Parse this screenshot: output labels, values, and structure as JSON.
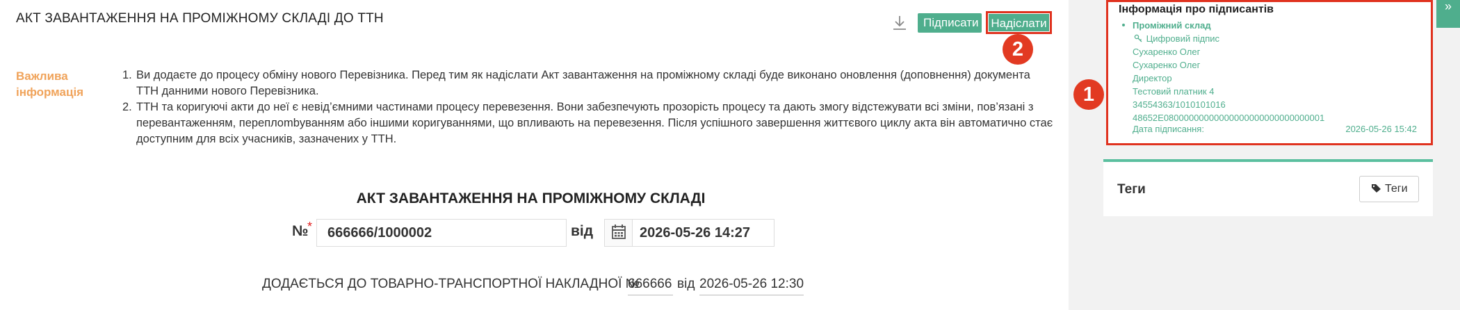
{
  "header": {
    "title": "АКТ ЗАВАНТАЖЕННЯ НА ПРОМІЖНОМУ СКЛАДІ ДО ТТН",
    "sign_label": "Підписати",
    "send_label": "Надіслати",
    "download_icon": "download-icon"
  },
  "callouts": {
    "one": "1",
    "two": "2"
  },
  "important": {
    "label": "Важлива інформація",
    "items": [
      {
        "num": "1.",
        "text": "Ви додаєте до процесу обміну нового Перевізника. Перед тим як надіслати Акт завантаження на проміжному складі буде виконано оновлення (доповнення) документа ТТН данними нового Перевізника."
      },
      {
        "num": "2.",
        "text": "ТТН та коригуючі акти до неї є невід’ємними частинами процесу перевезення. Вони забезпечують прозорість процесу та дають змогу відстежувати всі зміни, пов’язані з перевантаженням, переплombуванням або іншими коригуваннями, що впливають на перевезення. Після успішного завершення життєвого циклу акта він автоматично стає доступним для всіх учасників, зазначених у ТТН."
      }
    ]
  },
  "act": {
    "title": "АКТ ЗАВАНТАЖЕННЯ НА ПРОМІЖНОМУ СКЛАДІ",
    "number_label": "№",
    "required_mark": "*",
    "number_value": "666666/1000002",
    "date_label": "від",
    "date_value": "2026-05-26 14:27",
    "calendar_icon": "calendar-icon"
  },
  "attach": {
    "text": "ДОДАЄТЬСЯ ДО ТОВАРНО-ТРАНСПОРТНОЇ НАКЛАДНОЇ №",
    "ttn_number": "666666",
    "date_label": "від",
    "ttn_date": "2026-05-26 12:30"
  },
  "signers": {
    "title": "Інформація про підписантів",
    "warehouse": "Проміжний склад",
    "signature_type": "Цифровий підпис",
    "lines": [
      "Сухаренко Олег",
      "Сухаренко Олег",
      "Директор",
      "Тестовий платник 4",
      "34554363/1010101016",
      "48652E08000000000000000000000000000001"
    ],
    "date_label": "Дата підписання:",
    "date_value": "2026-05-26 15:42"
  },
  "tags": {
    "title": "Теги",
    "button_label": "Теги",
    "tag_icon": "tag-icon"
  },
  "side_toggle": "»",
  "colors": {
    "accent": "#4fae8d",
    "highlight": "#e0321f",
    "important": "#f0a35a"
  }
}
